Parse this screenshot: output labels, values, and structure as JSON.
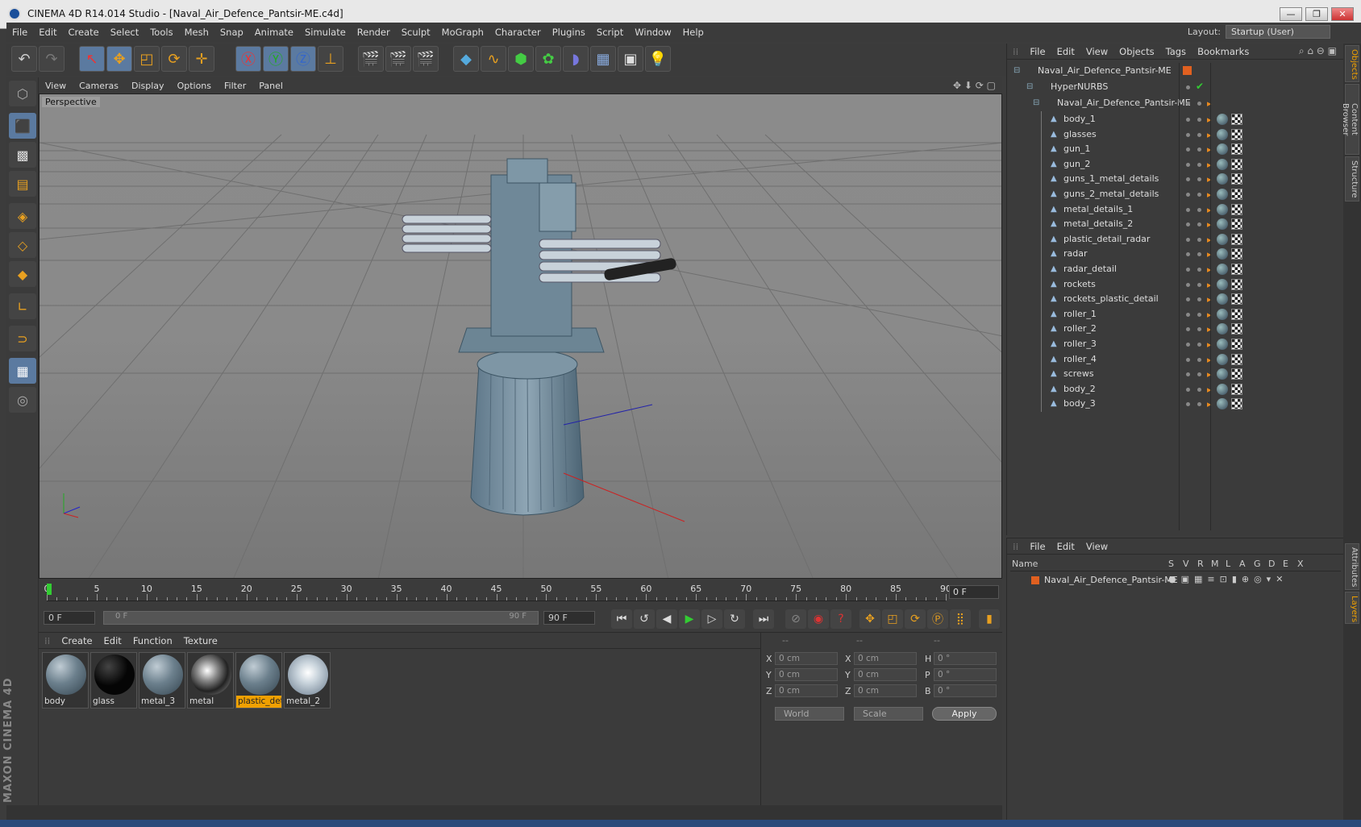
{
  "window": {
    "title": "CINEMA 4D R14.014 Studio - [Naval_Air_Defence_Pantsir-ME.c4d]",
    "btn_min": "—",
    "btn_max": "❐",
    "btn_close": "✕"
  },
  "menu": [
    "File",
    "Edit",
    "Create",
    "Select",
    "Tools",
    "Mesh",
    "Snap",
    "Animate",
    "Simulate",
    "Render",
    "Sculpt",
    "MoGraph",
    "Character",
    "Plugins",
    "Script",
    "Window",
    "Help"
  ],
  "layout": {
    "label": "Layout:",
    "value": "Startup (User)"
  },
  "viewport": {
    "menu": [
      "View",
      "Cameras",
      "Display",
      "Options",
      "Filter",
      "Panel"
    ],
    "label": "Perspective"
  },
  "timeline": {
    "ticks": [
      "0",
      "5",
      "10",
      "15",
      "20",
      "25",
      "30",
      "35",
      "40",
      "45",
      "50",
      "55",
      "60",
      "65",
      "70",
      "75",
      "80",
      "85",
      "90"
    ],
    "frame": "0 F"
  },
  "transport": {
    "start": "0 F",
    "range_start": "0 F",
    "range_end": "90 F",
    "end": "90 F"
  },
  "materials": {
    "menu": [
      "Create",
      "Edit",
      "Function",
      "Texture"
    ],
    "items": [
      {
        "name": "body",
        "kind": "metal"
      },
      {
        "name": "glass",
        "kind": "black"
      },
      {
        "name": "metal_3",
        "kind": "metal"
      },
      {
        "name": "metal",
        "kind": "chrome"
      },
      {
        "name": "plastic_det",
        "kind": "metal",
        "selected": true
      },
      {
        "name": "metal_2",
        "kind": "white"
      }
    ]
  },
  "coords": {
    "headers": [
      "--",
      "--",
      "--"
    ],
    "rows": [
      {
        "a": "X",
        "av": "0 cm",
        "b": "X",
        "bv": "0 cm",
        "c": "H",
        "cv": "0 °"
      },
      {
        "a": "Y",
        "av": "0 cm",
        "b": "Y",
        "bv": "0 cm",
        "c": "P",
        "cv": "0 °"
      },
      {
        "a": "Z",
        "av": "0 cm",
        "b": "Z",
        "bv": "0 cm",
        "c": "B",
        "cv": "0 °"
      }
    ],
    "mode1": "World",
    "mode2": "Scale",
    "apply": "Apply"
  },
  "objects": {
    "menu": [
      "File",
      "Edit",
      "View",
      "Objects",
      "Tags",
      "Bookmarks"
    ],
    "root": "Naval_Air_Defence_Pantsir-ME",
    "hypernurbs": "HyperNURBS",
    "group": "Naval_Air_Defence_Pantsir-ME",
    "items": [
      "body_1",
      "glasses",
      "gun_1",
      "gun_2",
      "guns_1_metal_details",
      "guns_2_metal_details",
      "metal_details_1",
      "metal_details_2",
      "plastic_detail_radar",
      "radar",
      "radar_detail",
      "rockets",
      "rockets_plastic_detail",
      "roller_1",
      "roller_2",
      "roller_3",
      "roller_4",
      "screws",
      "body_2",
      "body_3"
    ]
  },
  "layers": {
    "menu": [
      "File",
      "Edit",
      "View"
    ],
    "headers": [
      "Name",
      "S",
      "V",
      "R",
      "M",
      "L",
      "A",
      "G",
      "D",
      "E",
      "X"
    ],
    "row": "Naval_Air_Defence_Pantsir-ME"
  },
  "sidetabs": [
    "Objects",
    "Content Browser",
    "Structure",
    "Attributes",
    "Layers"
  ],
  "brand": "MAXON CINEMA 4D",
  "colors": {
    "accent": "#f0a000",
    "selected": "#5b7aa0",
    "bg": "#3b3b3b"
  }
}
